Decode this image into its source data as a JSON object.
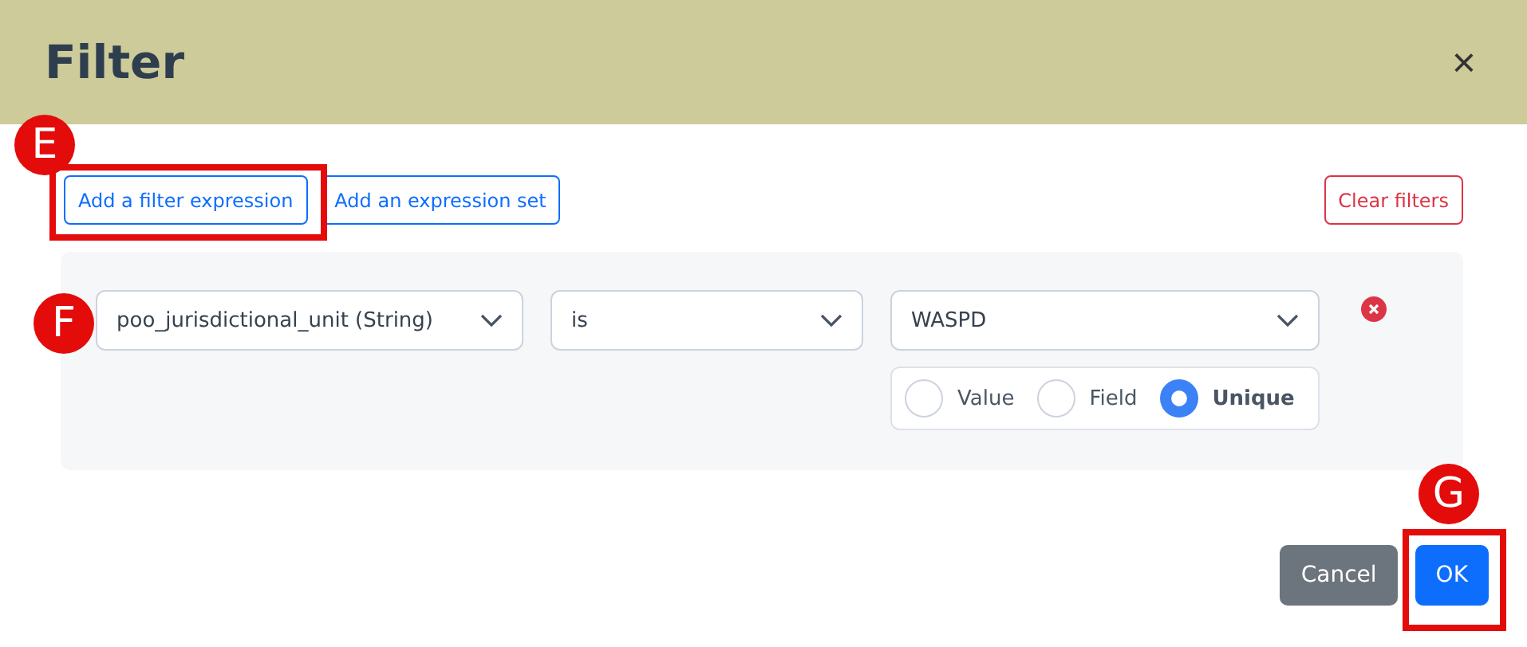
{
  "dialog": {
    "title": "Filter",
    "close": "×"
  },
  "toolbar": {
    "buttons": [
      "Add a filter expression",
      "Add an expression set"
    ],
    "clear": "Clear filters"
  },
  "expressions": [
    {
      "field": "poo_jurisdictional_unit (String)",
      "operator": "is",
      "value": "WASPD",
      "sources": [
        {
          "label": "Value",
          "selected": false
        },
        {
          "label": "Field",
          "selected": false
        },
        {
          "label": "Unique",
          "selected": true
        }
      ]
    }
  ],
  "footer": {
    "cancel": "Cancel",
    "ok": "OK"
  },
  "annotations": [
    {
      "letter": "E",
      "framed": true
    },
    {
      "letter": "F",
      "framed": false
    },
    {
      "letter": "G",
      "framed": true
    }
  ]
}
